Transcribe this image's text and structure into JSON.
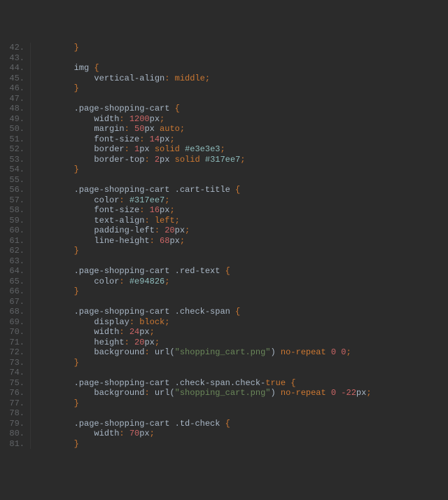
{
  "gutter": {
    "start": 42,
    "end": 81
  },
  "lines": [
    {
      "n": 42,
      "t": [
        {
          "c": "pn",
          "s": "        }"
        }
      ]
    },
    {
      "n": 43,
      "t": [
        {
          "c": "",
          "s": ""
        }
      ]
    },
    {
      "n": 44,
      "t": [
        {
          "c": "sel",
          "s": "        img "
        },
        {
          "c": "pn",
          "s": "{"
        }
      ]
    },
    {
      "n": 45,
      "t": [
        {
          "c": "prp",
          "s": "            vertical-align"
        },
        {
          "c": "pn",
          "s": ": "
        },
        {
          "c": "kw",
          "s": "middle"
        },
        {
          "c": "pn",
          "s": ";"
        }
      ]
    },
    {
      "n": 46,
      "t": [
        {
          "c": "pn",
          "s": "        }"
        }
      ]
    },
    {
      "n": 47,
      "t": [
        {
          "c": "",
          "s": ""
        }
      ]
    },
    {
      "n": 48,
      "t": [
        {
          "c": "sel",
          "s": "        .page-shopping-cart "
        },
        {
          "c": "pn",
          "s": "{"
        }
      ]
    },
    {
      "n": 49,
      "t": [
        {
          "c": "prp",
          "s": "            width"
        },
        {
          "c": "pn",
          "s": ": "
        },
        {
          "c": "num",
          "s": "1200"
        },
        {
          "c": "unit",
          "s": "px"
        },
        {
          "c": "pn",
          "s": ";"
        }
      ]
    },
    {
      "n": 50,
      "t": [
        {
          "c": "prp",
          "s": "            margin"
        },
        {
          "c": "pn",
          "s": ": "
        },
        {
          "c": "num",
          "s": "50"
        },
        {
          "c": "unit",
          "s": "px "
        },
        {
          "c": "kw",
          "s": "auto"
        },
        {
          "c": "pn",
          "s": ";"
        }
      ]
    },
    {
      "n": 51,
      "t": [
        {
          "c": "prp",
          "s": "            font-size"
        },
        {
          "c": "pn",
          "s": ": "
        },
        {
          "c": "num",
          "s": "14"
        },
        {
          "c": "unit",
          "s": "px"
        },
        {
          "c": "pn",
          "s": ";"
        }
      ]
    },
    {
      "n": 52,
      "t": [
        {
          "c": "prp",
          "s": "            border"
        },
        {
          "c": "pn",
          "s": ": "
        },
        {
          "c": "num",
          "s": "1"
        },
        {
          "c": "unit",
          "s": "px "
        },
        {
          "c": "kw",
          "s": "solid "
        },
        {
          "c": "clr",
          "s": "#e3e3e3"
        },
        {
          "c": "pn",
          "s": ";"
        }
      ]
    },
    {
      "n": 53,
      "t": [
        {
          "c": "prp",
          "s": "            border-top"
        },
        {
          "c": "pn",
          "s": ": "
        },
        {
          "c": "num",
          "s": "2"
        },
        {
          "c": "unit",
          "s": "px "
        },
        {
          "c": "kw",
          "s": "solid "
        },
        {
          "c": "clr",
          "s": "#317ee7"
        },
        {
          "c": "pn",
          "s": ";"
        }
      ]
    },
    {
      "n": 54,
      "t": [
        {
          "c": "pn",
          "s": "        }"
        }
      ]
    },
    {
      "n": 55,
      "t": [
        {
          "c": "",
          "s": ""
        }
      ]
    },
    {
      "n": 56,
      "t": [
        {
          "c": "sel",
          "s": "        .page-shopping-cart .cart-title "
        },
        {
          "c": "pn",
          "s": "{"
        }
      ]
    },
    {
      "n": 57,
      "t": [
        {
          "c": "prp",
          "s": "            color"
        },
        {
          "c": "pn",
          "s": ": "
        },
        {
          "c": "clr",
          "s": "#317ee7"
        },
        {
          "c": "pn",
          "s": ";"
        }
      ]
    },
    {
      "n": 58,
      "t": [
        {
          "c": "prp",
          "s": "            font-size"
        },
        {
          "c": "pn",
          "s": ": "
        },
        {
          "c": "num",
          "s": "16"
        },
        {
          "c": "unit",
          "s": "px"
        },
        {
          "c": "pn",
          "s": ";"
        }
      ]
    },
    {
      "n": 59,
      "t": [
        {
          "c": "prp",
          "s": "            text-align"
        },
        {
          "c": "pn",
          "s": ": "
        },
        {
          "c": "kw",
          "s": "left"
        },
        {
          "c": "pn",
          "s": ";"
        }
      ]
    },
    {
      "n": 60,
      "t": [
        {
          "c": "prp",
          "s": "            padding-left"
        },
        {
          "c": "pn",
          "s": ": "
        },
        {
          "c": "num",
          "s": "20"
        },
        {
          "c": "unit",
          "s": "px"
        },
        {
          "c": "pn",
          "s": ";"
        }
      ]
    },
    {
      "n": 61,
      "t": [
        {
          "c": "prp",
          "s": "            line-height"
        },
        {
          "c": "pn",
          "s": ": "
        },
        {
          "c": "num",
          "s": "68"
        },
        {
          "c": "unit",
          "s": "px"
        },
        {
          "c": "pn",
          "s": ";"
        }
      ]
    },
    {
      "n": 62,
      "t": [
        {
          "c": "pn",
          "s": "        }"
        }
      ]
    },
    {
      "n": 63,
      "t": [
        {
          "c": "",
          "s": ""
        }
      ]
    },
    {
      "n": 64,
      "t": [
        {
          "c": "sel",
          "s": "        .page-shopping-cart .red-text "
        },
        {
          "c": "pn",
          "s": "{"
        }
      ]
    },
    {
      "n": 65,
      "t": [
        {
          "c": "prp",
          "s": "            color"
        },
        {
          "c": "pn",
          "s": ": "
        },
        {
          "c": "clr",
          "s": "#e94826"
        },
        {
          "c": "pn",
          "s": ";"
        }
      ]
    },
    {
      "n": 66,
      "t": [
        {
          "c": "pn",
          "s": "        }"
        }
      ]
    },
    {
      "n": 67,
      "t": [
        {
          "c": "",
          "s": ""
        }
      ]
    },
    {
      "n": 68,
      "t": [
        {
          "c": "sel",
          "s": "        .page-shopping-cart .check-span "
        },
        {
          "c": "pn",
          "s": "{"
        }
      ]
    },
    {
      "n": 69,
      "t": [
        {
          "c": "prp",
          "s": "            display"
        },
        {
          "c": "pn",
          "s": ": "
        },
        {
          "c": "kw",
          "s": "block"
        },
        {
          "c": "pn",
          "s": ";"
        }
      ]
    },
    {
      "n": 70,
      "t": [
        {
          "c": "prp",
          "s": "            width"
        },
        {
          "c": "pn",
          "s": ": "
        },
        {
          "c": "num",
          "s": "24"
        },
        {
          "c": "unit",
          "s": "px"
        },
        {
          "c": "pn",
          "s": ";"
        }
      ]
    },
    {
      "n": 71,
      "t": [
        {
          "c": "prp",
          "s": "            height"
        },
        {
          "c": "pn",
          "s": ": "
        },
        {
          "c": "num",
          "s": "20"
        },
        {
          "c": "unit",
          "s": "px"
        },
        {
          "c": "pn",
          "s": ";"
        }
      ]
    },
    {
      "n": 72,
      "t": [
        {
          "c": "prp",
          "s": "            background"
        },
        {
          "c": "pn",
          "s": ": "
        },
        {
          "c": "url",
          "s": "url("
        },
        {
          "c": "str",
          "s": "\"shopping_cart.png\""
        },
        {
          "c": "url",
          "s": ") "
        },
        {
          "c": "kw",
          "s": "no-repeat "
        },
        {
          "c": "num",
          "s": "0 0"
        },
        {
          "c": "pn",
          "s": ";"
        }
      ]
    },
    {
      "n": 73,
      "t": [
        {
          "c": "pn",
          "s": "        }"
        }
      ]
    },
    {
      "n": 74,
      "t": [
        {
          "c": "",
          "s": ""
        }
      ]
    },
    {
      "n": 75,
      "t": [
        {
          "c": "sel",
          "s": "        .page-shopping-cart .check-span.check-"
        },
        {
          "c": "bool",
          "s": "true"
        },
        {
          "c": "sel",
          "s": " "
        },
        {
          "c": "pn",
          "s": "{"
        }
      ]
    },
    {
      "n": 76,
      "t": [
        {
          "c": "prp",
          "s": "            background"
        },
        {
          "c": "pn",
          "s": ": "
        },
        {
          "c": "url",
          "s": "url("
        },
        {
          "c": "str",
          "s": "\"shopping_cart.png\""
        },
        {
          "c": "url",
          "s": ") "
        },
        {
          "c": "kw",
          "s": "no-repeat "
        },
        {
          "c": "num",
          "s": "0 -22"
        },
        {
          "c": "unit",
          "s": "px"
        },
        {
          "c": "pn",
          "s": ";"
        }
      ]
    },
    {
      "n": 77,
      "t": [
        {
          "c": "pn",
          "s": "        }"
        }
      ]
    },
    {
      "n": 78,
      "t": [
        {
          "c": "",
          "s": ""
        }
      ]
    },
    {
      "n": 79,
      "t": [
        {
          "c": "sel",
          "s": "        .page-shopping-cart .td-check "
        },
        {
          "c": "pn",
          "s": "{"
        }
      ]
    },
    {
      "n": 80,
      "t": [
        {
          "c": "prp",
          "s": "            width"
        },
        {
          "c": "pn",
          "s": ": "
        },
        {
          "c": "num",
          "s": "70"
        },
        {
          "c": "unit",
          "s": "px"
        },
        {
          "c": "pn",
          "s": ";"
        }
      ]
    },
    {
      "n": 81,
      "t": [
        {
          "c": "pn",
          "s": "        }"
        }
      ]
    }
  ]
}
